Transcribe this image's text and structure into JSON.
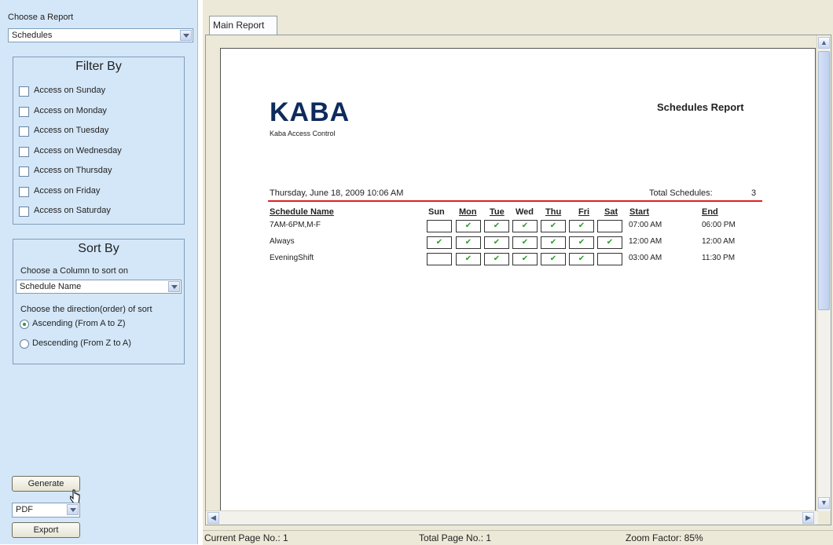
{
  "left_panel": {
    "choose_report_label": "Choose a Report",
    "report_select_value": "Schedules",
    "filter": {
      "title": "Filter By",
      "items": [
        {
          "label": "Access on Sunday",
          "checked": false
        },
        {
          "label": "Access on Monday",
          "checked": false
        },
        {
          "label": "Access on Tuesday",
          "checked": false
        },
        {
          "label": "Access on Wednesday",
          "checked": false
        },
        {
          "label": "Access on Thursday",
          "checked": false
        },
        {
          "label": "Access on Friday",
          "checked": false
        },
        {
          "label": "Access on Saturday",
          "checked": false
        }
      ]
    },
    "sort": {
      "title": "Sort By",
      "column_label": "Choose a Column to sort on",
      "column_value": "Schedule Name",
      "direction_label": "Choose the direction(order) of sort",
      "ascending_label": "Ascending (From A to Z)",
      "descending_label": "Descending (From Z to A)",
      "selected": "ascending"
    },
    "generate_label": "Generate",
    "format_value": "PDF",
    "export_label": "Export"
  },
  "tabs": [
    {
      "label": "Main Report",
      "active": true
    }
  ],
  "report": {
    "logo_text": "KABA",
    "logo_subtitle": "Kaba Access Control",
    "title": "Schedules Report",
    "date": "Thursday, June 18, 2009 10:06 AM",
    "total_label": "Total Schedules:",
    "total_value": "3",
    "columns": {
      "name": "Schedule Name",
      "sun": "Sun",
      "mon": "Mon",
      "tue": "Tue",
      "wed": "Wed",
      "thu": "Thu",
      "fri": "Fri",
      "sat": "Sat",
      "start": "Start",
      "end": "End"
    },
    "check_glyph": "✔",
    "rows": [
      {
        "name": "7AM-6PM,M-F",
        "days": [
          false,
          true,
          true,
          true,
          true,
          true,
          false
        ],
        "start": "07:00 AM",
        "end": "06:00 PM"
      },
      {
        "name": "Always",
        "days": [
          true,
          true,
          true,
          true,
          true,
          true,
          true
        ],
        "start": "12:00 AM",
        "end": "12:00 AM"
      },
      {
        "name": "EveningShift",
        "days": [
          false,
          true,
          true,
          true,
          true,
          true,
          false
        ],
        "start": "03:00 AM",
        "end": "11:30 PM"
      }
    ]
  },
  "status_bar": {
    "current_page": "Current Page No.: 1",
    "total_page": "Total Page No.: 1",
    "zoom": "Zoom Factor: 85%"
  },
  "colors": {
    "panel_bg": "#d4e7f8",
    "accent_red": "#dd2222",
    "check_green": "#2b9a2b",
    "logo_navy": "#0d2b5c"
  }
}
